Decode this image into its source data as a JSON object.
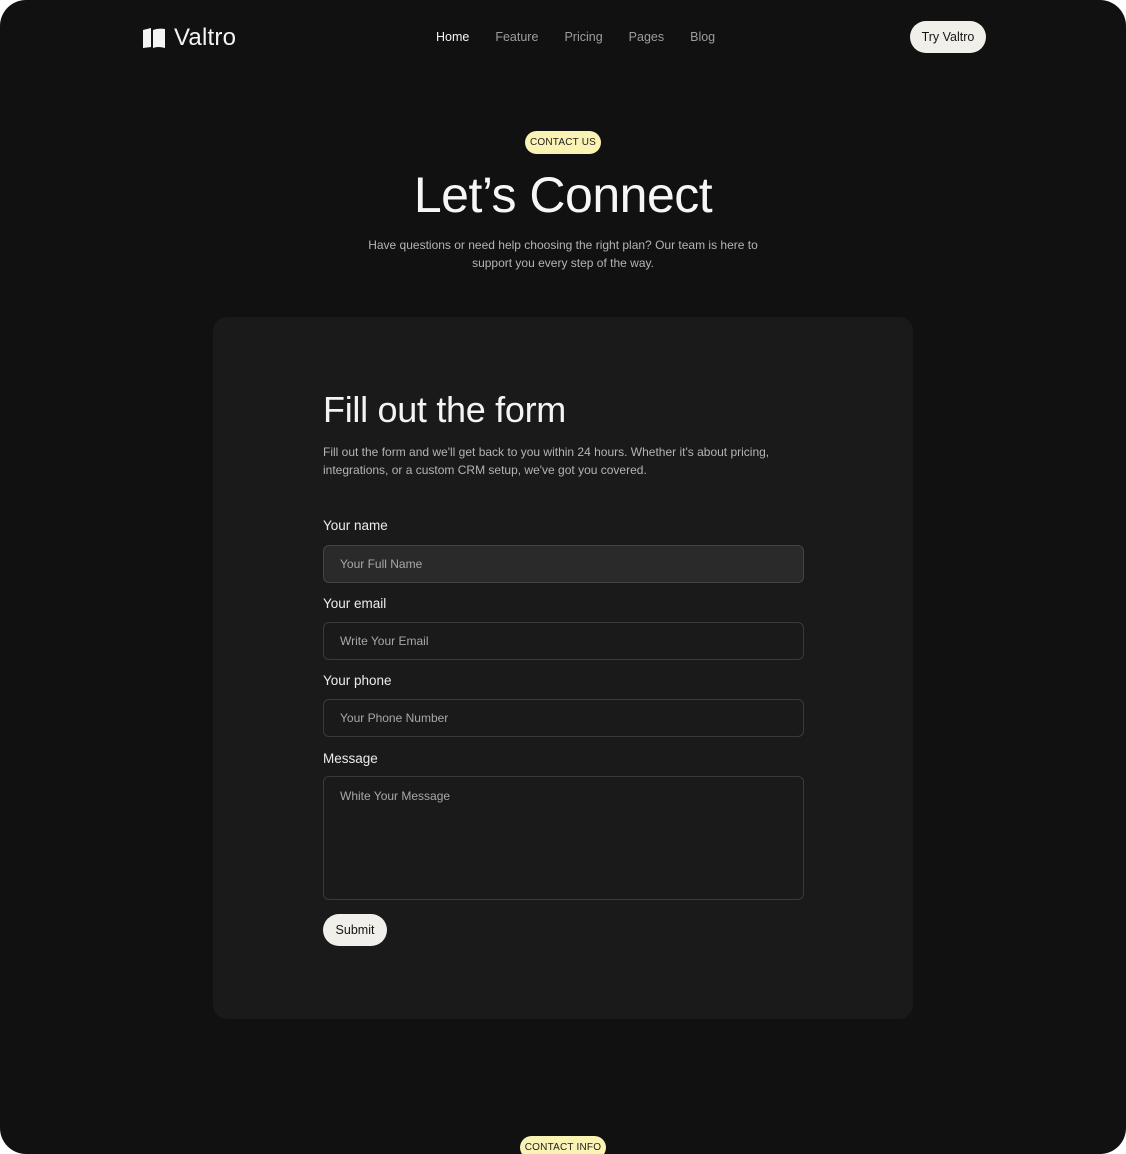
{
  "brand": {
    "name": "Valtro",
    "logo_icon": "book-pages-icon"
  },
  "nav": {
    "items": [
      {
        "label": "Home",
        "active": true
      },
      {
        "label": "Feature",
        "active": false
      },
      {
        "label": "Pricing",
        "active": false
      },
      {
        "label": "Pages",
        "active": false
      },
      {
        "label": "Blog",
        "active": false
      }
    ],
    "cta_label": "Try Valtro"
  },
  "hero": {
    "badge": "CONTACT US",
    "title": "Let’s Connect",
    "subtitle": "Have questions or need help choosing the right plan? Our team is here to support you every step of the way."
  },
  "form": {
    "title": "Fill out the form",
    "description": "Fill out the form and we'll get back to you within 24 hours. Whether it's about pricing, integrations, or a custom CRM setup, we've got you covered.",
    "fields": {
      "name": {
        "label": "Your name",
        "placeholder": "Your Full Name",
        "value": ""
      },
      "email": {
        "label": "Your email",
        "placeholder": "Write Your Email",
        "value": ""
      },
      "phone": {
        "label": "Your phone",
        "placeholder": "Your Phone Number",
        "value": ""
      },
      "message": {
        "label": "Message",
        "placeholder": "White Your Message",
        "value": ""
      }
    },
    "submit_label": "Submit"
  },
  "next_section": {
    "badge": "CONTACT INFO"
  },
  "colors": {
    "background": "#111111",
    "card": "#1a1a1a",
    "badge": "#faf3b4",
    "button": "#f1efe9",
    "text": "#f4f4f4",
    "muted": "#b4b4b4"
  }
}
